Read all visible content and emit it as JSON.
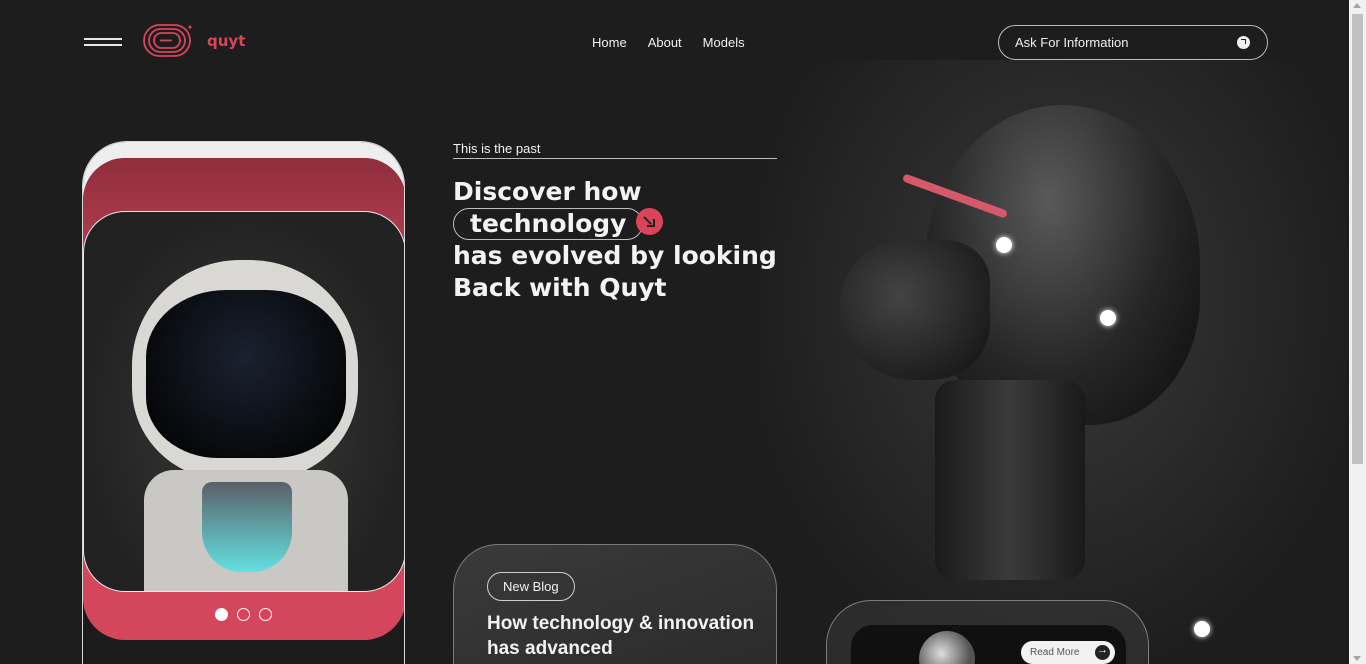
{
  "header": {
    "brand": "quyt",
    "nav": [
      "Home",
      "About",
      "Models"
    ],
    "ask_label": "Ask For Information"
  },
  "hero": {
    "eyebrow": "This is the past",
    "headline_line1": "Discover how",
    "headline_pill": "technology",
    "headline_line3": "has evolved by looking",
    "headline_line4": "Back with Quyt"
  },
  "blog": {
    "badge": "New Blog",
    "title": "How technology & innovation has advanced"
  },
  "model_card": {
    "read_more": "Read More"
  },
  "carousel": {
    "count": 3,
    "active_index": 0
  },
  "colors": {
    "accent": "#d9445a",
    "background": "#1e1d1d"
  }
}
